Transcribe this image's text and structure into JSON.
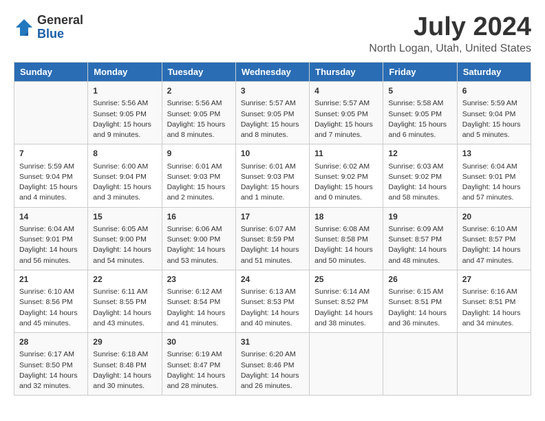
{
  "logo": {
    "general": "General",
    "blue": "Blue"
  },
  "title": "July 2024",
  "subtitle": "North Logan, Utah, United States",
  "headers": [
    "Sunday",
    "Monday",
    "Tuesday",
    "Wednesday",
    "Thursday",
    "Friday",
    "Saturday"
  ],
  "weeks": [
    [
      {
        "day": "",
        "info": ""
      },
      {
        "day": "1",
        "info": "Sunrise: 5:56 AM\nSunset: 9:05 PM\nDaylight: 15 hours\nand 9 minutes."
      },
      {
        "day": "2",
        "info": "Sunrise: 5:56 AM\nSunset: 9:05 PM\nDaylight: 15 hours\nand 8 minutes."
      },
      {
        "day": "3",
        "info": "Sunrise: 5:57 AM\nSunset: 9:05 PM\nDaylight: 15 hours\nand 8 minutes."
      },
      {
        "day": "4",
        "info": "Sunrise: 5:57 AM\nSunset: 9:05 PM\nDaylight: 15 hours\nand 7 minutes."
      },
      {
        "day": "5",
        "info": "Sunrise: 5:58 AM\nSunset: 9:05 PM\nDaylight: 15 hours\nand 6 minutes."
      },
      {
        "day": "6",
        "info": "Sunrise: 5:59 AM\nSunset: 9:04 PM\nDaylight: 15 hours\nand 5 minutes."
      }
    ],
    [
      {
        "day": "7",
        "info": "Sunrise: 5:59 AM\nSunset: 9:04 PM\nDaylight: 15 hours\nand 4 minutes."
      },
      {
        "day": "8",
        "info": "Sunrise: 6:00 AM\nSunset: 9:04 PM\nDaylight: 15 hours\nand 3 minutes."
      },
      {
        "day": "9",
        "info": "Sunrise: 6:01 AM\nSunset: 9:03 PM\nDaylight: 15 hours\nand 2 minutes."
      },
      {
        "day": "10",
        "info": "Sunrise: 6:01 AM\nSunset: 9:03 PM\nDaylight: 15 hours\nand 1 minute."
      },
      {
        "day": "11",
        "info": "Sunrise: 6:02 AM\nSunset: 9:02 PM\nDaylight: 15 hours\nand 0 minutes."
      },
      {
        "day": "12",
        "info": "Sunrise: 6:03 AM\nSunset: 9:02 PM\nDaylight: 14 hours\nand 58 minutes."
      },
      {
        "day": "13",
        "info": "Sunrise: 6:04 AM\nSunset: 9:01 PM\nDaylight: 14 hours\nand 57 minutes."
      }
    ],
    [
      {
        "day": "14",
        "info": "Sunrise: 6:04 AM\nSunset: 9:01 PM\nDaylight: 14 hours\nand 56 minutes."
      },
      {
        "day": "15",
        "info": "Sunrise: 6:05 AM\nSunset: 9:00 PM\nDaylight: 14 hours\nand 54 minutes."
      },
      {
        "day": "16",
        "info": "Sunrise: 6:06 AM\nSunset: 9:00 PM\nDaylight: 14 hours\nand 53 minutes."
      },
      {
        "day": "17",
        "info": "Sunrise: 6:07 AM\nSunset: 8:59 PM\nDaylight: 14 hours\nand 51 minutes."
      },
      {
        "day": "18",
        "info": "Sunrise: 6:08 AM\nSunset: 8:58 PM\nDaylight: 14 hours\nand 50 minutes."
      },
      {
        "day": "19",
        "info": "Sunrise: 6:09 AM\nSunset: 8:57 PM\nDaylight: 14 hours\nand 48 minutes."
      },
      {
        "day": "20",
        "info": "Sunrise: 6:10 AM\nSunset: 8:57 PM\nDaylight: 14 hours\nand 47 minutes."
      }
    ],
    [
      {
        "day": "21",
        "info": "Sunrise: 6:10 AM\nSunset: 8:56 PM\nDaylight: 14 hours\nand 45 minutes."
      },
      {
        "day": "22",
        "info": "Sunrise: 6:11 AM\nSunset: 8:55 PM\nDaylight: 14 hours\nand 43 minutes."
      },
      {
        "day": "23",
        "info": "Sunrise: 6:12 AM\nSunset: 8:54 PM\nDaylight: 14 hours\nand 41 minutes."
      },
      {
        "day": "24",
        "info": "Sunrise: 6:13 AM\nSunset: 8:53 PM\nDaylight: 14 hours\nand 40 minutes."
      },
      {
        "day": "25",
        "info": "Sunrise: 6:14 AM\nSunset: 8:52 PM\nDaylight: 14 hours\nand 38 minutes."
      },
      {
        "day": "26",
        "info": "Sunrise: 6:15 AM\nSunset: 8:51 PM\nDaylight: 14 hours\nand 36 minutes."
      },
      {
        "day": "27",
        "info": "Sunrise: 6:16 AM\nSunset: 8:51 PM\nDaylight: 14 hours\nand 34 minutes."
      }
    ],
    [
      {
        "day": "28",
        "info": "Sunrise: 6:17 AM\nSunset: 8:50 PM\nDaylight: 14 hours\nand 32 minutes."
      },
      {
        "day": "29",
        "info": "Sunrise: 6:18 AM\nSunset: 8:48 PM\nDaylight: 14 hours\nand 30 minutes."
      },
      {
        "day": "30",
        "info": "Sunrise: 6:19 AM\nSunset: 8:47 PM\nDaylight: 14 hours\nand 28 minutes."
      },
      {
        "day": "31",
        "info": "Sunrise: 6:20 AM\nSunset: 8:46 PM\nDaylight: 14 hours\nand 26 minutes."
      },
      {
        "day": "",
        "info": ""
      },
      {
        "day": "",
        "info": ""
      },
      {
        "day": "",
        "info": ""
      }
    ]
  ]
}
